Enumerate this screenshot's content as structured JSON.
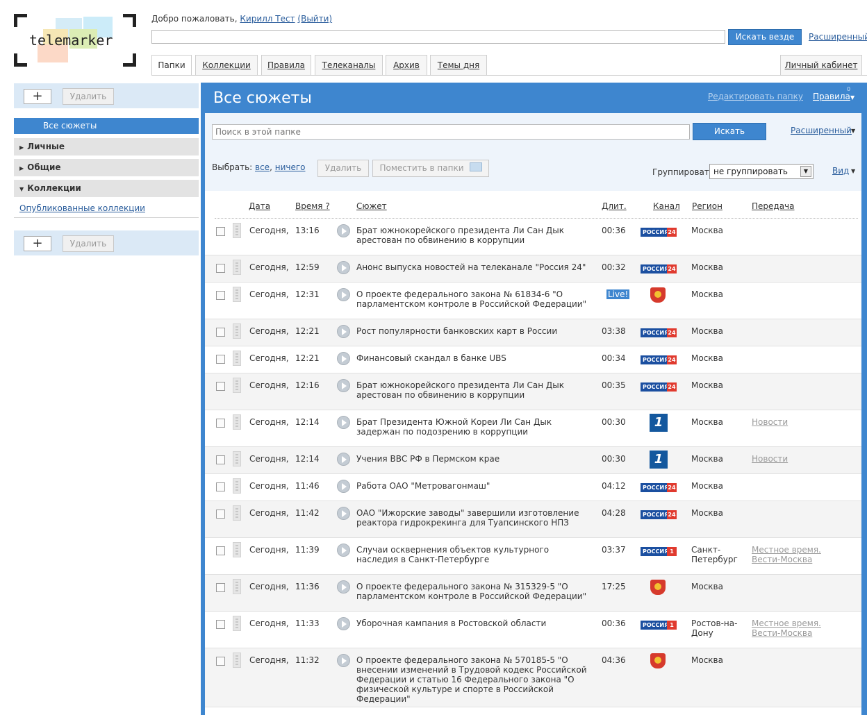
{
  "header": {
    "logo_text": "telemarker",
    "welcome_prefix": "Добро пожаловать,",
    "user_name": "Кирилл Тест",
    "logout": "(Выйти)",
    "search_button": "Искать везде",
    "advanced": "Расширенный"
  },
  "tabs": [
    "Папки",
    "Коллекции",
    "Правила",
    "Телеканалы",
    "Архив",
    "Темы дня"
  ],
  "cabinet": "Личный кабинет",
  "sidebar": {
    "add": "+",
    "delete": "Удалить",
    "all_stories": "Все сюжеты",
    "groups": [
      "Личные",
      "Общие",
      "Коллекции"
    ],
    "published": "Опубликованные коллекции"
  },
  "main": {
    "title": "Все сюжеты",
    "edit_folder": "Редактировать папку",
    "rules": "Правила",
    "rules_count": "0",
    "search_placeholder": "Поиск в этой папке",
    "search_button": "Искать",
    "advanced": "Расширенный",
    "select_label": "Выбрать:",
    "select_all": "все",
    "select_none": "ничего",
    "delete": "Удалить",
    "move_to_folders": "Поместить в папки",
    "group_label": "Группировать:",
    "group_value": "не группировать",
    "view": "Вид"
  },
  "table": {
    "columns": [
      "Дата",
      "Время ?",
      "Сюжет",
      "Длит.",
      "Канал",
      "Регион",
      "Передача"
    ],
    "rows": [
      {
        "date": "Сегодня,",
        "time": "13:16",
        "plot": "Брат южнокорейского президента Ли Сан Дык арестован по обвинению в коррупции",
        "dur": "00:36",
        "channel": "russia24",
        "channel_text": "РОССИЯ",
        "channel_num": "24",
        "region": "Москва",
        "show": ""
      },
      {
        "date": "Сегодня,",
        "time": "12:59",
        "plot": "Анонс выпуска новостей на телеканале \"Россия 24\"",
        "dur": "00:32",
        "channel": "russia24",
        "channel_text": "РОССИЯ",
        "channel_num": "24",
        "region": "Москва",
        "show": ""
      },
      {
        "date": "Сегодня,",
        "time": "12:31",
        "plot": "О проекте федерального закона № 61834-6 \"О парламентском контроле в Российской Федерации\"",
        "dur": "Live!",
        "channel": "crest",
        "channel_text": "",
        "channel_num": "",
        "region": "Москва",
        "show": ""
      },
      {
        "date": "Сегодня,",
        "time": "12:21",
        "plot": "Рост популярности банковских карт в России",
        "dur": "03:38",
        "channel": "russia24",
        "channel_text": "РОССИЯ",
        "channel_num": "24",
        "region": "Москва",
        "show": ""
      },
      {
        "date": "Сегодня,",
        "time": "12:21",
        "plot": "Финансовый скандал в банке UBS",
        "dur": "00:34",
        "channel": "russia24",
        "channel_text": "РОССИЯ",
        "channel_num": "24",
        "region": "Москва",
        "show": ""
      },
      {
        "date": "Сегодня,",
        "time": "12:16",
        "plot": "Брат южнокорейского президента Ли Сан Дык арестован по обвинению в коррупции",
        "dur": "00:35",
        "channel": "russia24",
        "channel_text": "РОССИЯ",
        "channel_num": "24",
        "region": "Москва",
        "show": ""
      },
      {
        "date": "Сегодня,",
        "time": "12:14",
        "plot": "Брат Президента Южной Кореи Ли Сан Дык задержан по подозрению в коррупции",
        "dur": "00:30",
        "channel": "perviy",
        "channel_text": "1",
        "channel_num": "",
        "region": "Москва",
        "show": "Новости"
      },
      {
        "date": "Сегодня,",
        "time": "12:14",
        "plot": "Учения ВВС РФ в Пермском крае",
        "dur": "00:30",
        "channel": "perviy",
        "channel_text": "1",
        "channel_num": "",
        "region": "Москва",
        "show": "Новости"
      },
      {
        "date": "Сегодня,",
        "time": "11:46",
        "plot": "Работа ОАО \"Метровагонмаш\"",
        "dur": "04:12",
        "channel": "russia24",
        "channel_text": "РОССИЯ",
        "channel_num": "24",
        "region": "Москва",
        "show": ""
      },
      {
        "date": "Сегодня,",
        "time": "11:42",
        "plot": "ОАО \"Ижорские заводы\" завершили изготовление реактора гидрокрекинга для Туапсинского НПЗ",
        "dur": "04:28",
        "channel": "russia24",
        "channel_text": "РОССИЯ",
        "channel_num": "24",
        "region": "Москва",
        "show": ""
      },
      {
        "date": "Сегодня,",
        "time": "11:39",
        "plot": "Случаи осквернения объектов культурного наследия в Санкт-Петербурге",
        "dur": "03:37",
        "channel": "russia1",
        "channel_text": "РОССИЯ",
        "channel_num": "1",
        "region": "Санкт-Петербург",
        "show": "Местное время. Вести-Москва"
      },
      {
        "date": "Сегодня,",
        "time": "11:36",
        "plot": "О проекте федерального закона № 315329-5 \"О парламентском контроле в Российской Федерации\"",
        "dur": "17:25",
        "channel": "crest",
        "channel_text": "",
        "channel_num": "",
        "region": "Москва",
        "show": ""
      },
      {
        "date": "Сегодня,",
        "time": "11:33",
        "plot": "Уборочная кампания в Ростовской области",
        "dur": "00:36",
        "channel": "russia1",
        "channel_text": "РОССИЯ",
        "channel_num": "1",
        "region": "Ростов-на-Дону",
        "show": "Местное время. Вести-Москва"
      },
      {
        "date": "Сегодня,",
        "time": "11:32",
        "plot": "О проекте федерального закона № 570185-5 \"О внесении изменений в Трудовой кодекс Российской Федерации и статью 16 Федерального закона \"О физической культуре и спорте в Российской Федерации\"",
        "dur": "04:36",
        "channel": "crest",
        "channel_text": "",
        "channel_num": "",
        "region": "Москва",
        "show": ""
      }
    ]
  },
  "colors": {
    "accent": "#3e86cf",
    "sidebar_tool": "#dbe9f6",
    "link": "#2a5d9c",
    "channel_blue": "#1b4fa0",
    "channel_red": "#e03a2e"
  }
}
